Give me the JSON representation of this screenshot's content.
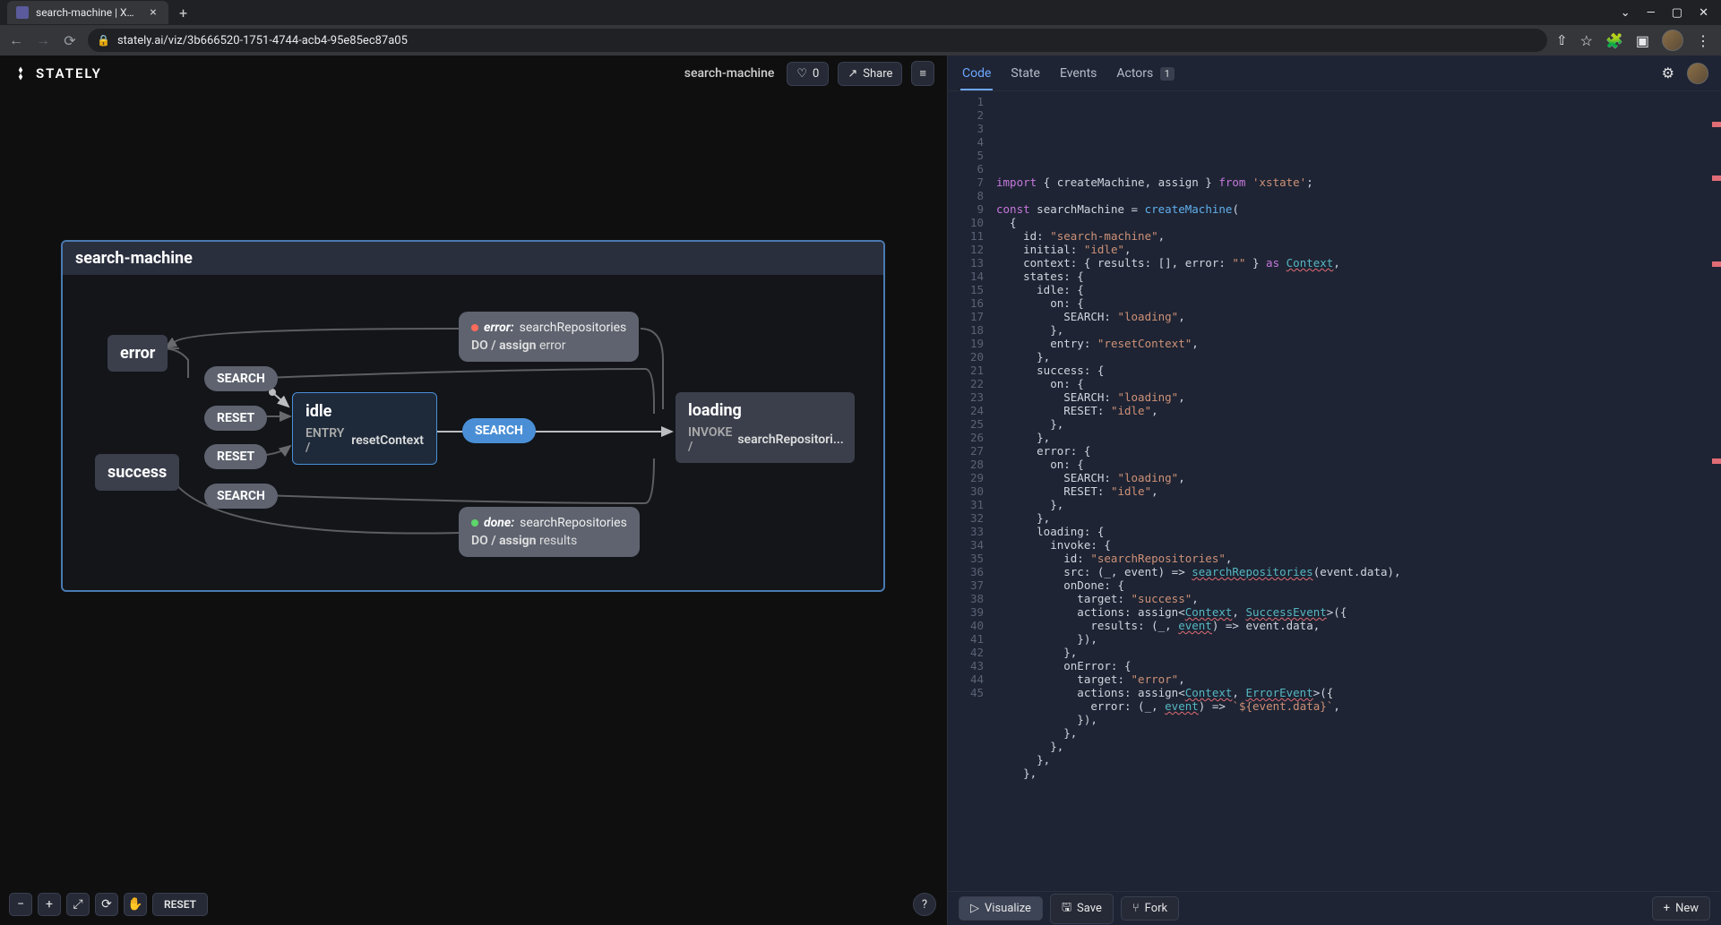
{
  "browser": {
    "tab_title": "search-machine | XState Visualiz",
    "url": "stately.ai/viz/3b666520-1751-4744-acb4-95e85ec87a05"
  },
  "header": {
    "logo_text": "STATELY",
    "machine_name": "search-machine",
    "likes": "0",
    "share_label": "Share"
  },
  "code_tabs": {
    "code": "Code",
    "state": "State",
    "events": "Events",
    "actors": "Actors",
    "actors_badge": "1"
  },
  "viz": {
    "machine_title": "search-machine",
    "states": {
      "error": "error",
      "idle": "idle",
      "success": "success",
      "loading": "loading"
    },
    "idle_entry_label": "ENTRY /",
    "idle_entry_action": "resetContext",
    "loading_invoke_label": "INVOKE /",
    "loading_invoke_src": "searchRepositori...",
    "events": {
      "search": "SEARCH",
      "reset": "RESET"
    },
    "error_box": {
      "label": "error:",
      "src": "searchRepositories",
      "do": "DO /",
      "assign": "assign",
      "target": "error"
    },
    "done_box": {
      "label": "done:",
      "src": "searchRepositories",
      "do": "DO /",
      "assign": "assign",
      "target": "results"
    },
    "reset_btn": "RESET"
  },
  "footer": {
    "visualize": "Visualize",
    "save": "Save",
    "fork": "Fork",
    "new": "New"
  },
  "code_lines": [
    {
      "n": 1,
      "h": "<span class='tk-kw'>import</span> { createMachine, assign } <span class='tk-kw'>from</span> <span class='tk-str'>'xstate'</span>;"
    },
    {
      "n": 2,
      "h": ""
    },
    {
      "n": 3,
      "h": "<span class='tk-kw'>const</span> <span class='tk-id'>searchMachine</span> = <span class='tk-fn'>createMachine</span>("
    },
    {
      "n": 4,
      "h": "  {"
    },
    {
      "n": 5,
      "h": "    id: <span class='tk-str'>\"search-machine\"</span>,"
    },
    {
      "n": 6,
      "h": "    initial: <span class='tk-str'>\"idle\"</span>,"
    },
    {
      "n": 7,
      "h": "    context: { results: [], error: <span class='tk-str'>\"\"</span> } <span class='tk-kw'>as</span> <span class='tk-type'>Context</span>,"
    },
    {
      "n": 8,
      "h": "    states: {"
    },
    {
      "n": 9,
      "h": "      idle: {"
    },
    {
      "n": 10,
      "h": "        on: {"
    },
    {
      "n": 11,
      "h": "          SEARCH: <span class='tk-str'>\"loading\"</span>,"
    },
    {
      "n": 12,
      "h": "        },"
    },
    {
      "n": 13,
      "h": "        entry: <span class='tk-str'>\"resetContext\"</span>,"
    },
    {
      "n": 14,
      "h": "      },"
    },
    {
      "n": 15,
      "h": "      success: {"
    },
    {
      "n": 16,
      "h": "        on: {"
    },
    {
      "n": 17,
      "h": "          SEARCH: <span class='tk-str'>\"loading\"</span>,"
    },
    {
      "n": 18,
      "h": "          RESET: <span class='tk-str'>\"idle\"</span>,"
    },
    {
      "n": 19,
      "h": "        },"
    },
    {
      "n": 20,
      "h": "      },"
    },
    {
      "n": 21,
      "h": "      error: {"
    },
    {
      "n": 22,
      "h": "        on: {"
    },
    {
      "n": 23,
      "h": "          SEARCH: <span class='tk-str'>\"loading\"</span>,"
    },
    {
      "n": 24,
      "h": "          RESET: <span class='tk-str'>\"idle\"</span>,"
    },
    {
      "n": 25,
      "h": "        },"
    },
    {
      "n": 26,
      "h": "      },"
    },
    {
      "n": 27,
      "h": "      loading: {"
    },
    {
      "n": 28,
      "h": "        invoke: {"
    },
    {
      "n": 29,
      "h": "          id: <span class='tk-str'>\"searchRepositories\"</span>,"
    },
    {
      "n": 30,
      "h": "          src: (_, event) =&gt; <span class='tk-type'>searchRepositories</span>(event.data),"
    },
    {
      "n": 31,
      "h": "          onDone: {"
    },
    {
      "n": 32,
      "h": "            target: <span class='tk-str'>\"success\"</span>,"
    },
    {
      "n": 33,
      "h": "            actions: assign&lt;<span class='tk-type'>Context</span>, <span class='tk-type'>SuccessEvent</span>&gt;({"
    },
    {
      "n": 34,
      "h": "              results: (_, <span class='tk-type'>event</span>) =&gt; event.data,"
    },
    {
      "n": 35,
      "h": "            }),"
    },
    {
      "n": 36,
      "h": "          },"
    },
    {
      "n": 37,
      "h": "          onError: {"
    },
    {
      "n": 38,
      "h": "            target: <span class='tk-str'>\"error\"</span>,"
    },
    {
      "n": 39,
      "h": "            actions: assign&lt;<span class='tk-type'>Context</span>, <span class='tk-type'>ErrorEvent</span>&gt;({"
    },
    {
      "n": 40,
      "h": "              error: (_, <span class='tk-type'>event</span>) =&gt; <span class='tk-str'>`${event.data}`</span>,"
    },
    {
      "n": 41,
      "h": "            }),"
    },
    {
      "n": 42,
      "h": "          },"
    },
    {
      "n": 43,
      "h": "        },"
    },
    {
      "n": 44,
      "h": "      },"
    },
    {
      "n": 45,
      "h": "    },"
    }
  ]
}
